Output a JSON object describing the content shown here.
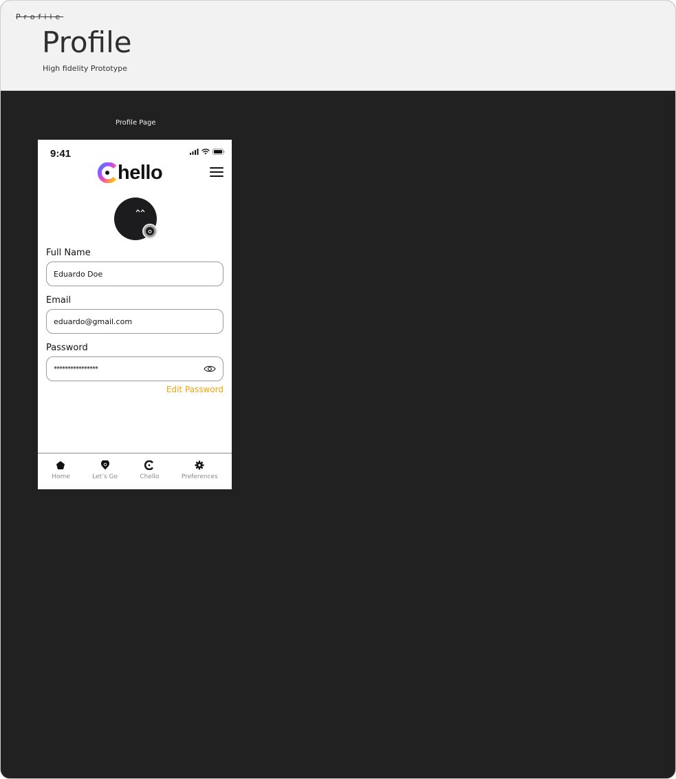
{
  "header": {
    "tag": "Profile",
    "title": "Profile",
    "subtitle": "High fidelity Prototype"
  },
  "page_label": "Profile Page",
  "status_bar": {
    "time": "9:41"
  },
  "app": {
    "logo_text": "hello"
  },
  "form": {
    "full_name": {
      "label": "Full Name",
      "value": "Eduardo Doe"
    },
    "email": {
      "label": "Email",
      "value": "eduardo@gmail.com"
    },
    "password": {
      "label": "Password",
      "value": "****************"
    },
    "edit_password_link": "Edit Password"
  },
  "tabs": [
    {
      "label": "Home",
      "icon": "home-icon"
    },
    {
      "label": "Let’s Go",
      "icon": "pin-icon"
    },
    {
      "label": "Chello",
      "icon": "chello-c-icon"
    },
    {
      "label": "Preferences",
      "icon": "gear-icon"
    }
  ],
  "colors": {
    "accent": "#f0a30a",
    "canvas": "#212121",
    "header_bg": "#f2f2f2"
  }
}
